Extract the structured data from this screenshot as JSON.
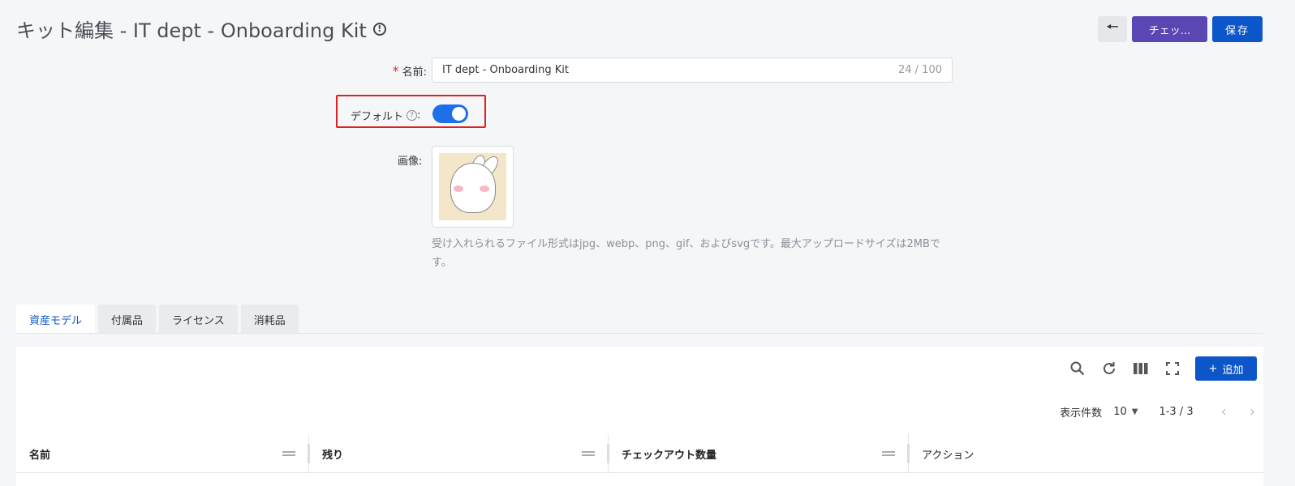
{
  "header": {
    "title": "キット編集 - IT dept - Onboarding Kit",
    "info_icon": "!",
    "back_icon": "🠔",
    "checkout_label": "チェッ...",
    "save_label": "保存"
  },
  "form": {
    "name": {
      "required_mark": "*",
      "label": "名前:",
      "value": "IT dept - Onboarding Kit",
      "counter": "24 / 100"
    },
    "default": {
      "label": "デフォルト",
      "colon": ":",
      "help_icon": "?",
      "enabled": true
    },
    "image": {
      "label": "画像:",
      "hint": "受け入れられるファイル形式はjpg、webp、png、gif、およびsvgです。最大アップロードサイズは2MBです。"
    }
  },
  "tabs": [
    {
      "label": "資産モデル",
      "active": true
    },
    {
      "label": "付属品",
      "active": false
    },
    {
      "label": "ライセンス",
      "active": false
    },
    {
      "label": "消耗品",
      "active": false
    }
  ],
  "toolbar": {
    "add_label": "追加",
    "add_icon": "+",
    "search_icon": "search-icon",
    "refresh_icon": "refresh-icon",
    "columns_icon": "columns-icon",
    "fullscreen_icon": "fullscreen-icon"
  },
  "pagination": {
    "per_page_label": "表示件数",
    "per_page_value": "10",
    "range": "1-3 / 3"
  },
  "table": {
    "columns": [
      "名前",
      "残り",
      "チェックアウト数量",
      "アクション"
    ]
  },
  "colors": {
    "primary": "#0d56c9",
    "checkout": "#5a47b3",
    "toggle": "#1e6fe8",
    "highlight": "#e02020"
  }
}
